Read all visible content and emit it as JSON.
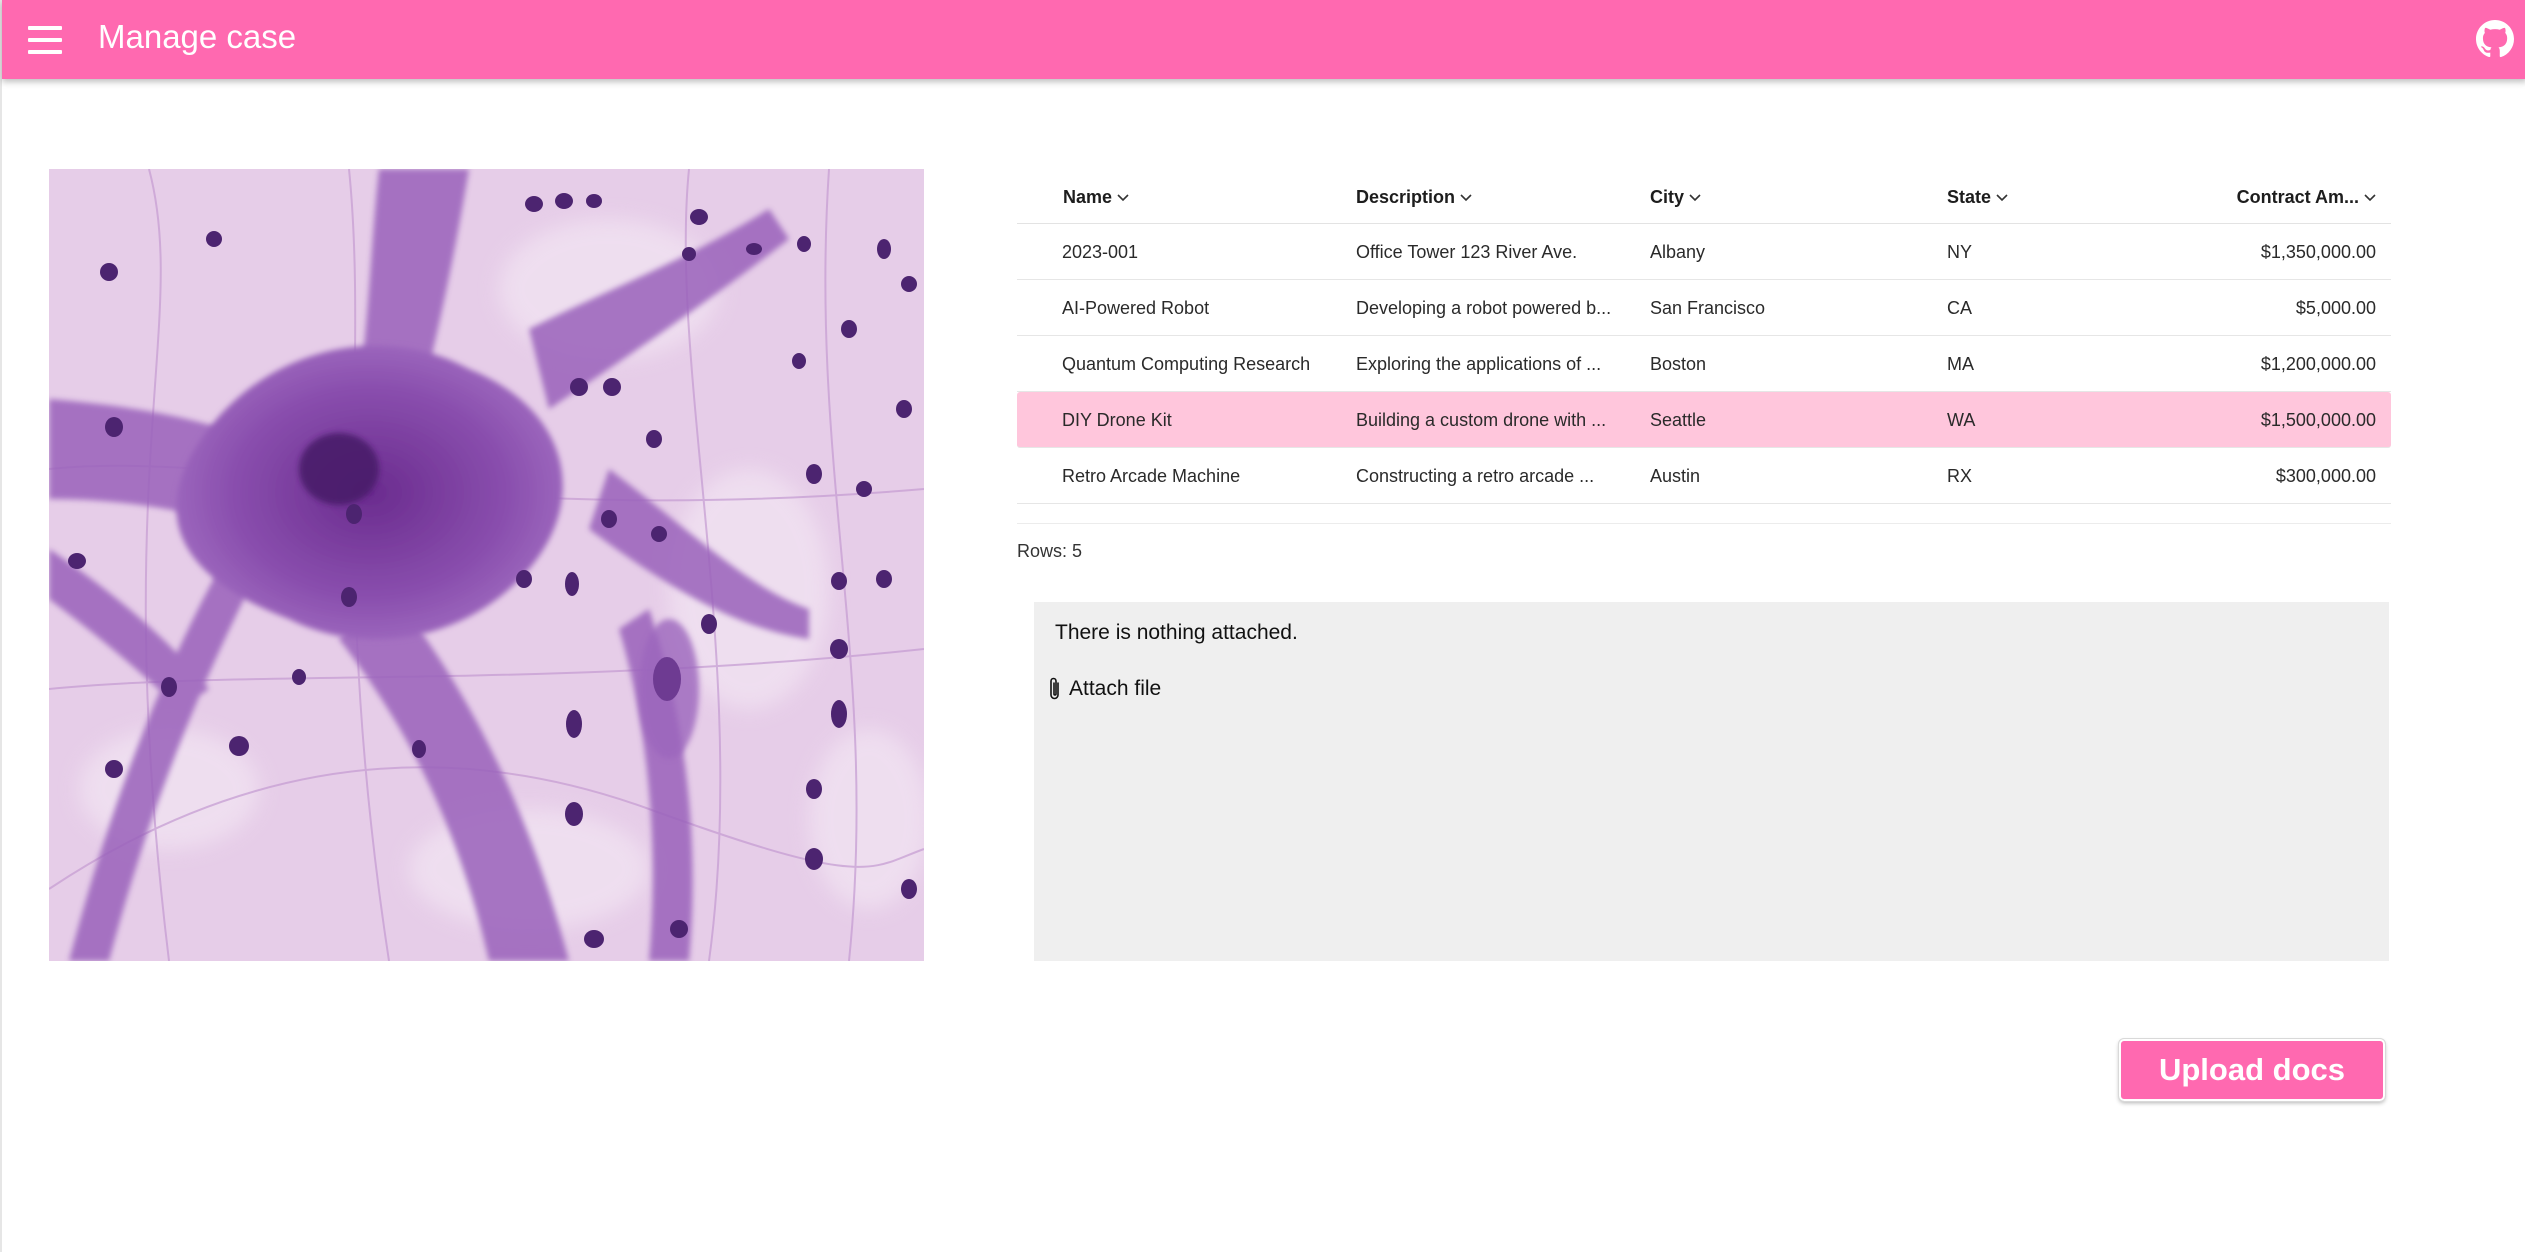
{
  "appbar": {
    "title": "Manage case",
    "menu_icon": "hamburger-menu-icon",
    "github_icon": "github-icon",
    "color": "#ff69b0"
  },
  "specimen": {
    "icon": "microscopy-image"
  },
  "table": {
    "columns": [
      "Name",
      "Description",
      "City",
      "State",
      "Contract Am..."
    ],
    "rows": [
      {
        "name": "2023-001",
        "description": "Office Tower 123 River Ave.",
        "city": "Albany",
        "state": "NY",
        "amount": "$1,350,000.00"
      },
      {
        "name": "AI-Powered Robot",
        "description": "Developing a robot powered b...",
        "city": "San Francisco",
        "state": "CA",
        "amount": "$5,000.00"
      },
      {
        "name": "Quantum Computing Research",
        "description": "Exploring the applications of ...",
        "city": "Boston",
        "state": "MA",
        "amount": "$1,200,000.00"
      },
      {
        "name": "DIY Drone Kit",
        "description": "Building a custom drone with ...",
        "city": "Seattle",
        "state": "WA",
        "amount": "$1,500,000.00"
      },
      {
        "name": "Retro Arcade Machine",
        "description": "Constructing a retro arcade ...",
        "city": "Austin",
        "state": "RX",
        "amount": "$300,000.00"
      }
    ],
    "selected_row_color": "#ffc6dc",
    "rows_count": "Rows: 5"
  },
  "attachments": {
    "message": "There is nothing attached.",
    "attach_label": "Attach file",
    "attach_icon": "paperclip-icon"
  },
  "upload_button": {
    "label": "Upload docs"
  }
}
